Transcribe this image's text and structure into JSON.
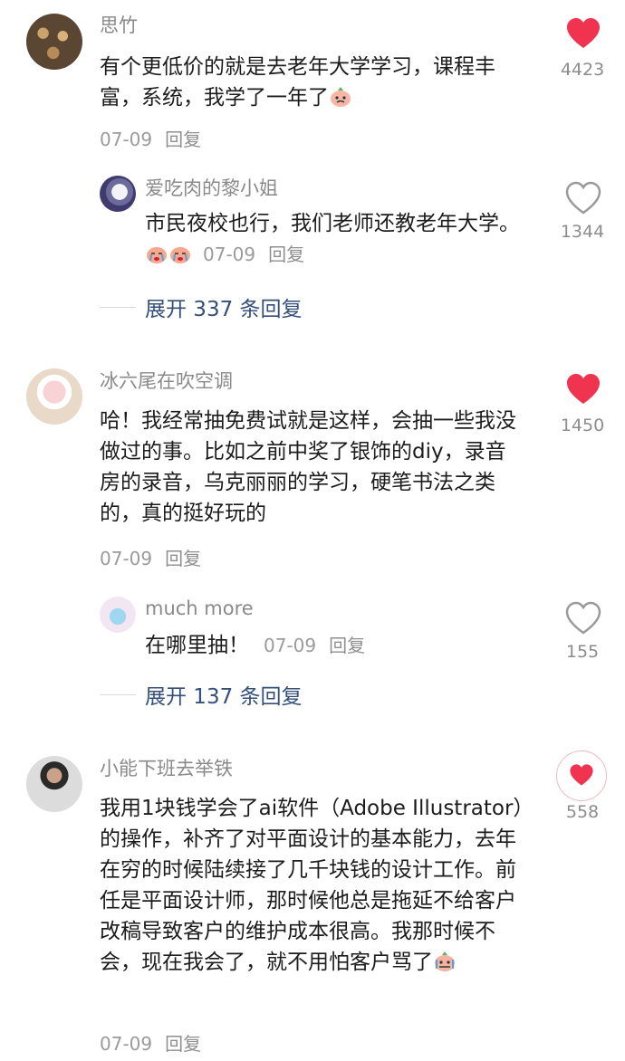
{
  "comments": [
    {
      "username": "思竹",
      "text": "有个更低价的就是去老年大学学习，课程丰富，系统，我学了一年了",
      "date": "07-09",
      "reply_label": "回复",
      "likes": "4423",
      "liked": true,
      "reply": {
        "username": "爱吃肉的黎小姐",
        "text": "市民夜校也行，我们老师还教老年大学。",
        "date": "07-09",
        "reply_label": "回复",
        "likes": "1344",
        "liked": false
      },
      "expand_label": "展开 337 条回复"
    },
    {
      "username": "冰六尾在吹空调",
      "text": "哈！我经常抽免费试就是这样，会抽一些我没做过的事。比如之前中奖了银饰的diy，录音房的录音，乌克丽丽的学习，硬笔书法之类的，真的挺好玩的",
      "date": "07-09",
      "reply_label": "回复",
      "likes": "1450",
      "liked": true,
      "reply": {
        "username": "much more",
        "text": "在哪里抽！",
        "date": "07-09",
        "reply_label": "回复",
        "likes": "155",
        "liked": false
      },
      "expand_label": "展开 137 条回复"
    },
    {
      "username": "小能下班去举铁",
      "text": "我用1块钱学会了ai软件（Adobe Illustrator）的操作，补齐了对平面设计的基本能力，去年在穷的时候陆续接了几千块钱的设计工作。前任是平面设计师，那时候他总是拖延不给客户改稿导致客户的维护成本很高。我那时候不会，现在我会了，就不用怕客户骂了",
      "date": "07-09",
      "reply_label": "回复",
      "likes": "558",
      "liked": true
    }
  ],
  "colors": {
    "heart_red": "#f0334f",
    "link_blue": "#34507a",
    "outline": "#9a9a9a"
  }
}
